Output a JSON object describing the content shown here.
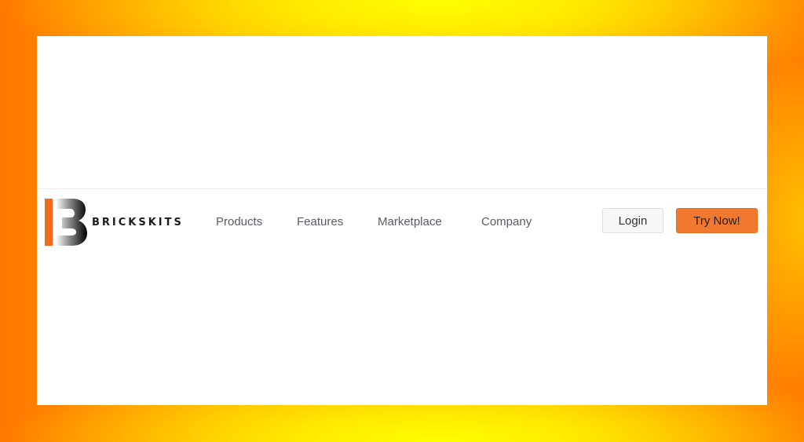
{
  "brand": {
    "name": "BRICKSKITS",
    "accent_color": "#f0792f",
    "logo_icon": "brickskits-logo-icon"
  },
  "nav": {
    "items": [
      {
        "label": "Products"
      },
      {
        "label": "Features"
      },
      {
        "label": "Marketplace"
      },
      {
        "label": "Company"
      }
    ]
  },
  "actions": {
    "login_label": "Login",
    "try_label": "Try Now!"
  },
  "colors": {
    "background_primary": "#ff8c00",
    "background_highlight": "#ffff00",
    "button_primary": "#f0792f",
    "button_secondary": "#f7f7f7"
  }
}
